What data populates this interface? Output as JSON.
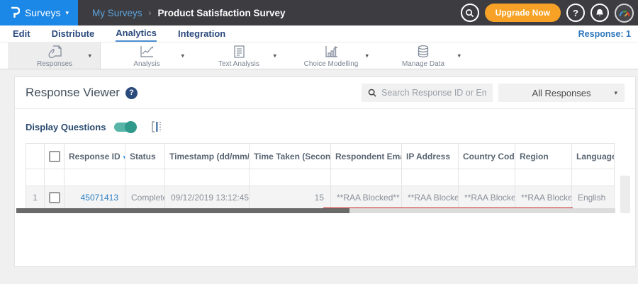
{
  "topbar": {
    "product": "Surveys",
    "breadcrumb": {
      "parent": "My Surveys",
      "separator": "›",
      "current": "Product Satisfaction Survey"
    },
    "upgrade_label": "Upgrade Now",
    "help_glyph": "?"
  },
  "navbar": {
    "items": [
      {
        "label": "Edit"
      },
      {
        "label": "Distribute"
      },
      {
        "label": "Analytics"
      },
      {
        "label": "Integration"
      }
    ],
    "response_count": "Response: 1"
  },
  "toolbar": {
    "items": [
      {
        "label": "Responses"
      },
      {
        "label": "Analysis"
      },
      {
        "label": "Text Analysis"
      },
      {
        "label": "Choice Modelling"
      },
      {
        "label": "Manage Data"
      }
    ]
  },
  "viewer": {
    "title": "Response Viewer",
    "help_glyph": "?",
    "search_placeholder": "Search Response ID or Email",
    "filter_dropdown_value": "All Responses",
    "display_questions_label": "Display Questions",
    "toggle_state": "on"
  },
  "table": {
    "columns": {
      "response_id": "Response ID",
      "status": "Status",
      "timestamp": "Timestamp (dd/mm/yyyy)",
      "time_taken": "Time Taken (Seconds)",
      "respondent_email": "Respondent Email",
      "ip_address": "IP Address",
      "country_code": "Country Code",
      "region": "Region",
      "language": "Language"
    },
    "rows": [
      {
        "num": "1",
        "response_id": "45071413",
        "status": "Completed",
        "timestamp": "09/12/2019 13:12:45",
        "time_taken": "15",
        "respondent_email": "**RAA Blocked**",
        "ip_address": "**RAA Blocked**",
        "country_code": "**RAA Blocked**",
        "region": "**RAA Blocked**",
        "language": "English"
      }
    ]
  },
  "icons": {
    "caret_down": "▾",
    "sort_desc": "▾",
    "sort_both": "⇅"
  },
  "colors": {
    "brand_blue": "#1b87e6",
    "header_dark": "#3c3c41",
    "upgrade_orange": "#f7a226",
    "toggle_teal": "#2f9a8c",
    "annotation_red": "#c2231d",
    "link_blue": "#2e7fc1"
  }
}
